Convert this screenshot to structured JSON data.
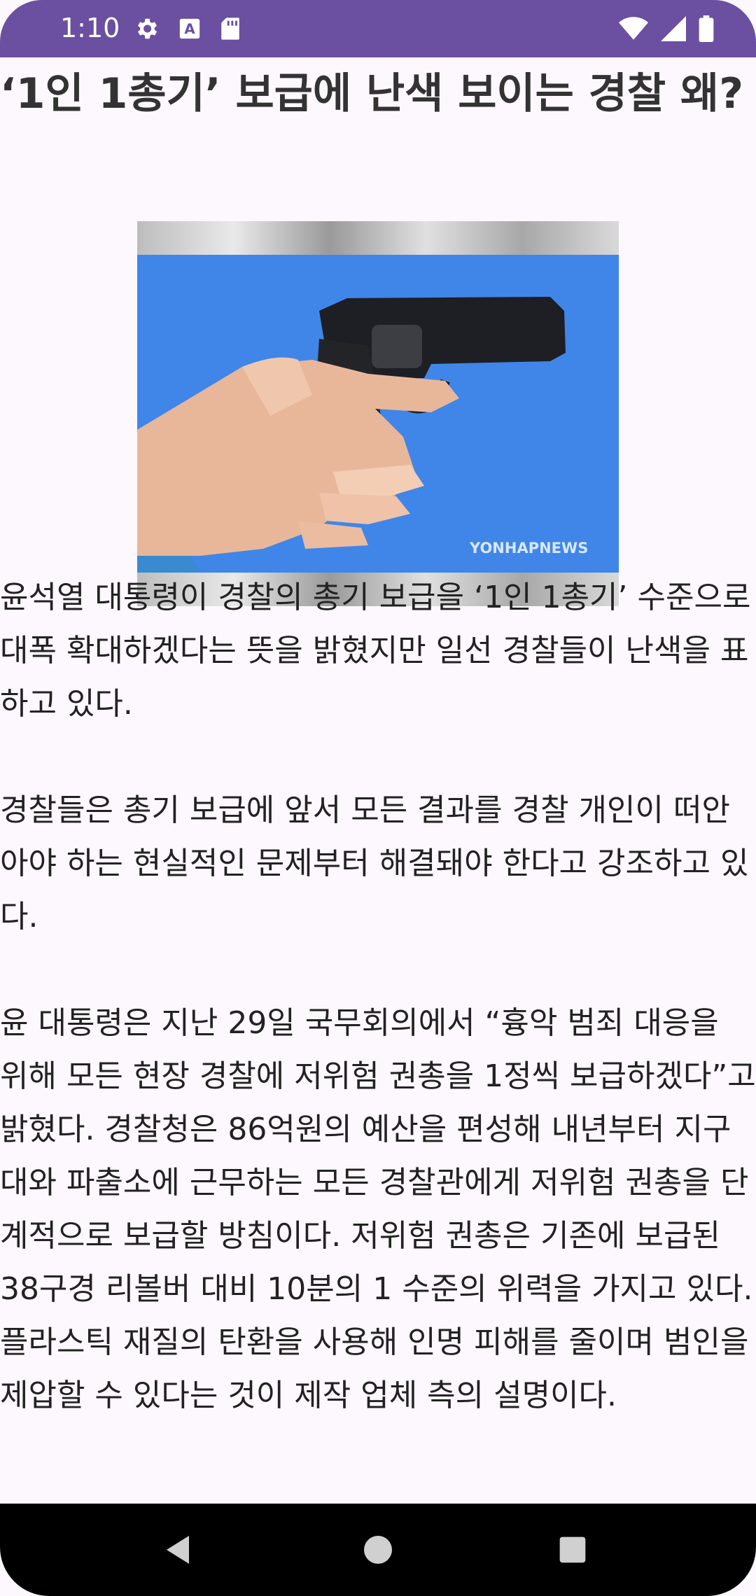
{
  "status_bar": {
    "time": "1:10",
    "left_icons": [
      "settings-gear-icon",
      "text-a-icon",
      "sd-card-icon"
    ],
    "right_icons": [
      "wifi-icon",
      "signal-icon",
      "battery-icon"
    ],
    "bar_color": "#6b4fa0"
  },
  "article": {
    "headline": "‘1인 1총기’ 보급에 난색 보이는 경찰 왜?",
    "image_watermark": "YONHAPNEWS",
    "paragraphs": [
      "윤석열 대통령이 경찰의 총기 보급을 ‘1인 1총기’ 수준으로 대폭 확대하겠다는 뜻을 밝혔지만 일선 경찰들이 난색을 표하고 있다.",
      "경찰들은 총기 보급에 앞서 모든 결과를 경찰 개인이 떠안아야 하는 현실적인 문제부터 해결돼야 한다고 강조하고 있다.",
      "윤 대통령은 지난 29일 국무회의에서 “흉악 범죄 대응을 위해 모든 현장 경찰에 저위험 권총을 1정씩 보급하겠다”고 밝혔다. 경찰청은 86억원의 예산을 편성해 내년부터 지구대와 파출소에 근무하는 모든 경찰관에게 저위험 권총을 단계적으로 보급할 방침이다. 저위험 권총은 기존에 보급된 38구경 리볼버 대비 10분의 1 수준의 위력을 가지고 있다. 플라스틱 재질의 탄환을 사용해 인명 피해를 줄이며 범인을 제압할 수 있다는 것이 제작 업체 측의 설명이다."
    ]
  },
  "nav_bar": {
    "buttons": [
      "back-icon",
      "home-icon",
      "recents-icon"
    ]
  }
}
